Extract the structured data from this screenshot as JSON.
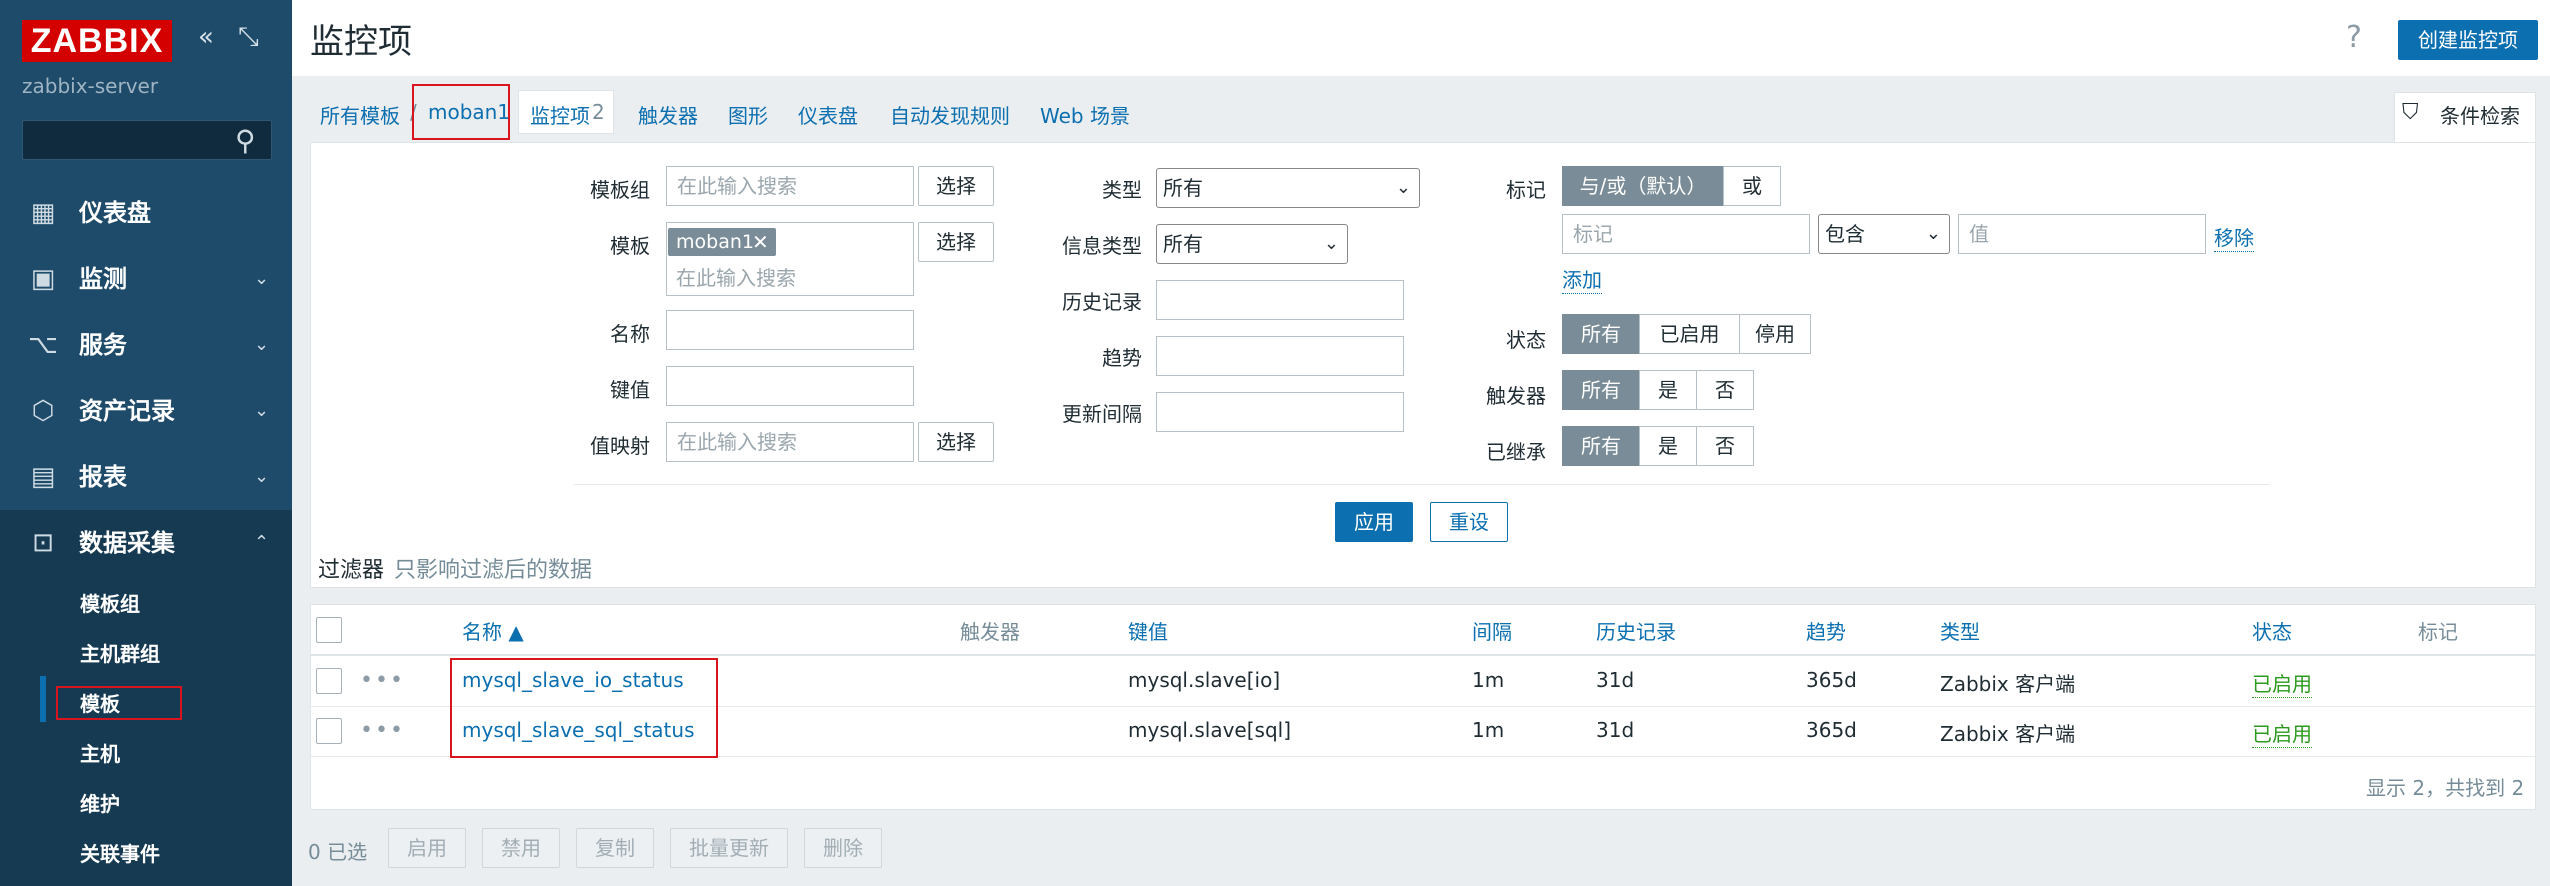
{
  "sidebar": {
    "logo": "ZABBIX",
    "server": "zabbix-server",
    "menu": [
      {
        "label": "仪表盘",
        "icon": "dashboard-icon"
      },
      {
        "label": "监测",
        "icon": "monitoring-icon"
      },
      {
        "label": "服务",
        "icon": "services-icon"
      },
      {
        "label": "资产记录",
        "icon": "inventory-icon"
      },
      {
        "label": "报表",
        "icon": "reports-icon"
      },
      {
        "label": "数据采集",
        "icon": "data-collection-icon"
      }
    ],
    "submenu": [
      "模板组",
      "主机群组",
      "模板",
      "主机",
      "维护",
      "关联事件"
    ]
  },
  "header": {
    "title": "监控项",
    "help": "?",
    "create_button": "创建监控项"
  },
  "tabs": {
    "all_templates": "所有模板",
    "separator": "/",
    "template": "moban1",
    "items": "监控项",
    "items_count": "2",
    "triggers": "触发器",
    "graphs": "图形",
    "dashboards": "仪表盘",
    "discovery": "自动发现规则",
    "web": "Web 场景",
    "filter": "条件检索"
  },
  "filter": {
    "template_group_label": "模板组",
    "template_label": "模板",
    "name_label": "名称",
    "key_label": "键值",
    "valuemap_label": "值映射",
    "search_placeholder": "在此输入搜索",
    "select": "选择",
    "template_tag": "moban1",
    "type_label": "类型",
    "type_value": "所有",
    "info_type_label": "信息类型",
    "info_type_value": "所有",
    "history_label": "历史记录",
    "trends_label": "趋势",
    "interval_label": "更新间隔",
    "tags_label": "标记",
    "andor": "与/或（默认）",
    "or": "或",
    "tag_placeholder": "标记",
    "operator": "包含",
    "value_placeholder": "值",
    "remove": "移除",
    "add": "添加",
    "state_label": "状态",
    "state_all": "所有",
    "state_enabled": "已启用",
    "state_disabled": "停用",
    "trigger_label": "触发器",
    "all": "所有",
    "yes": "是",
    "no": "否",
    "inherited_label": "已继承",
    "apply": "应用",
    "reset": "重设",
    "caption": "过滤器",
    "caption_sub": "只影响过滤后的数据"
  },
  "table": {
    "headers": {
      "name": "名称 ▲",
      "triggers": "触发器",
      "key": "键值",
      "interval": "间隔",
      "history": "历史记录",
      "trends": "趋势",
      "type": "类型",
      "status": "状态",
      "tags": "标记"
    },
    "rows": [
      {
        "dots": "•••",
        "name": "mysql_slave_io_status",
        "key": "mysql.slave[io]",
        "interval": "1m",
        "history": "31d",
        "trends": "365d",
        "type": "Zabbix 客户端",
        "status": "已启用"
      },
      {
        "dots": "•••",
        "name": "mysql_slave_sql_status",
        "key": "mysql.slave[sql]",
        "interval": "1m",
        "history": "31d",
        "trends": "365d",
        "type": "Zabbix 客户端",
        "status": "已启用"
      }
    ],
    "count": "显示 2，共找到 2"
  },
  "footer": {
    "selected": "0 已选",
    "enable": "启用",
    "disable": "禁用",
    "copy": "复制",
    "mass_update": "批量更新",
    "delete": "删除"
  },
  "colors": {
    "sidebar": "#1f4b6a",
    "accent": "#0b6fb0",
    "highlight": "#d8151f",
    "enabled": "#2c9a1e"
  }
}
